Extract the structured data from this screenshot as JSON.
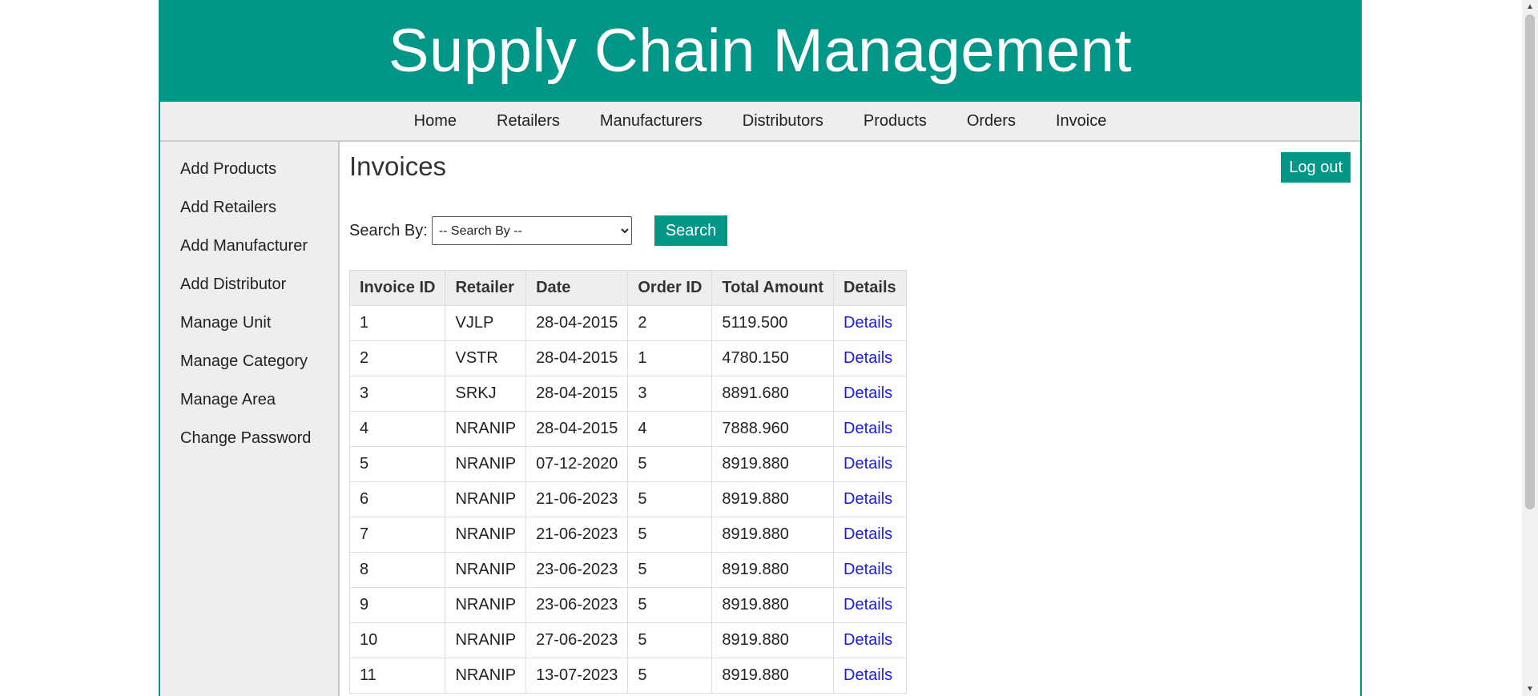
{
  "header": {
    "title": "Supply Chain Management"
  },
  "nav": {
    "items": [
      {
        "label": "Home"
      },
      {
        "label": "Retailers"
      },
      {
        "label": "Manufacturers"
      },
      {
        "label": "Distributors"
      },
      {
        "label": "Products"
      },
      {
        "label": "Orders"
      },
      {
        "label": "Invoice"
      }
    ]
  },
  "sidebar": {
    "items": [
      {
        "label": "Add Products"
      },
      {
        "label": "Add Retailers"
      },
      {
        "label": "Add Manufacturer"
      },
      {
        "label": "Add Distributor"
      },
      {
        "label": "Manage Unit"
      },
      {
        "label": "Manage Category"
      },
      {
        "label": "Manage Area"
      },
      {
        "label": "Change Password"
      }
    ]
  },
  "main": {
    "title": "Invoices",
    "logout_label": "Log out",
    "search": {
      "label": "Search By:",
      "selected": "-- Search By --",
      "button_label": "Search"
    }
  },
  "table": {
    "headers": {
      "invoice_id": "Invoice ID",
      "retailer": "Retailer",
      "date": "Date",
      "order_id": "Order ID",
      "total_amount": "Total Amount",
      "details": "Details"
    },
    "rows": [
      {
        "invoice_id": "1",
        "retailer": "VJLP",
        "date": "28-04-2015",
        "order_id": "2",
        "total_amount": "5119.500",
        "details": "Details"
      },
      {
        "invoice_id": "2",
        "retailer": "VSTR",
        "date": "28-04-2015",
        "order_id": "1",
        "total_amount": "4780.150",
        "details": "Details"
      },
      {
        "invoice_id": "3",
        "retailer": "SRKJ",
        "date": "28-04-2015",
        "order_id": "3",
        "total_amount": "8891.680",
        "details": "Details"
      },
      {
        "invoice_id": "4",
        "retailer": "NRANIP",
        "date": "28-04-2015",
        "order_id": "4",
        "total_amount": "7888.960",
        "details": "Details"
      },
      {
        "invoice_id": "5",
        "retailer": "NRANIP",
        "date": "07-12-2020",
        "order_id": "5",
        "total_amount": "8919.880",
        "details": "Details"
      },
      {
        "invoice_id": "6",
        "retailer": "NRANIP",
        "date": "21-06-2023",
        "order_id": "5",
        "total_amount": "8919.880",
        "details": "Details"
      },
      {
        "invoice_id": "7",
        "retailer": "NRANIP",
        "date": "21-06-2023",
        "order_id": "5",
        "total_amount": "8919.880",
        "details": "Details"
      },
      {
        "invoice_id": "8",
        "retailer": "NRANIP",
        "date": "23-06-2023",
        "order_id": "5",
        "total_amount": "8919.880",
        "details": "Details"
      },
      {
        "invoice_id": "9",
        "retailer": "NRANIP",
        "date": "23-06-2023",
        "order_id": "5",
        "total_amount": "8919.880",
        "details": "Details"
      },
      {
        "invoice_id": "10",
        "retailer": "NRANIP",
        "date": "27-06-2023",
        "order_id": "5",
        "total_amount": "8919.880",
        "details": "Details"
      },
      {
        "invoice_id": "11",
        "retailer": "NRANIP",
        "date": "13-07-2023",
        "order_id": "5",
        "total_amount": "8919.880",
        "details": "Details"
      }
    ]
  },
  "colors": {
    "accent": "#009688",
    "nav_bg": "#eeeeee",
    "link": "#1a1ae6"
  }
}
